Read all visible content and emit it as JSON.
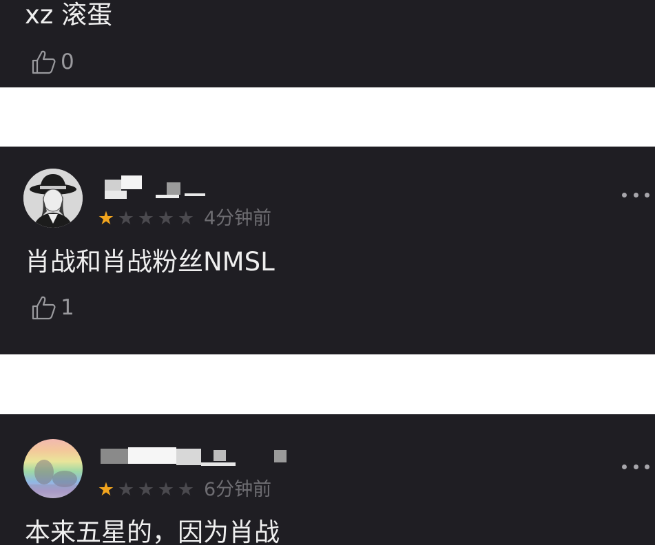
{
  "comments": [
    {
      "text": "xz 滚蛋",
      "likes": "0"
    },
    {
      "text": "肖战和肖战粉丝NMSL",
      "likes": "1",
      "rating": 1,
      "max_rating": 5,
      "time": "4分钟前"
    },
    {
      "text": "本来五星的，因为肖战",
      "rating": 1,
      "max_rating": 5,
      "time": "6分钟前"
    }
  ],
  "icons": {
    "like": "thumbs-up-icon",
    "more": "more-dots-icon",
    "star": "star-icon"
  },
  "colors": {
    "card_background": "#1f1e23",
    "page_background": "#ffffff",
    "star_active": "#f2a51e",
    "star_inactive": "#4a494e",
    "meta_text": "#6e6d72"
  }
}
